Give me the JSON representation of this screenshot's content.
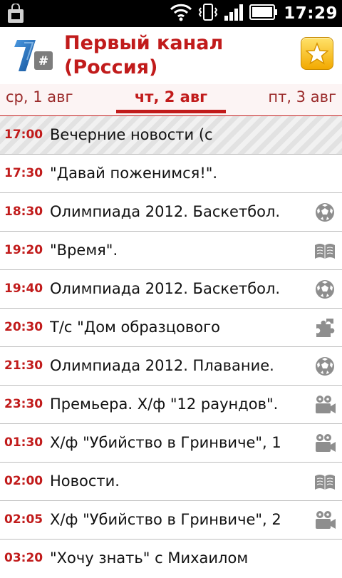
{
  "status_bar": {
    "time": "17:29",
    "icons": [
      "shopping-bag-icon",
      "wifi-icon",
      "vibrate-icon",
      "signal-icon",
      "battery-icon"
    ]
  },
  "header": {
    "logo_icon": "channel-one-logo",
    "title": "Первый канал (Россия)",
    "favorite_icon": "star-icon"
  },
  "date_tabs": {
    "prev": "ср, 1 авг",
    "current": "чт, 2 авг",
    "next": "пт, 3 авг"
  },
  "colors": {
    "accent": "#c11b1b",
    "star_button": "#f5b800"
  },
  "programs": [
    {
      "time": "17:00",
      "title": "Вечерние новости (с",
      "icon": "",
      "current": true
    },
    {
      "time": "17:30",
      "title": "\"Давай поженимся!\".",
      "icon": ""
    },
    {
      "time": "18:30",
      "title": "Олимпиада 2012. Баскетбол.",
      "icon": "sport-ball-icon"
    },
    {
      "time": "19:20",
      "title": "\"Время\".",
      "icon": "open-book-icon"
    },
    {
      "time": "19:40",
      "title": "Олимпиада 2012. Баскетбол.",
      "icon": "sport-ball-icon"
    },
    {
      "time": "20:30",
      "title": "Т/с \"Дом образцового",
      "icon": "puzzle-icon"
    },
    {
      "time": "21:30",
      "title": "Олимпиада 2012. Плавание.",
      "icon": "sport-ball-icon"
    },
    {
      "time": "23:30",
      "title": "Премьера. Х/ф \"12 раундов\".",
      "icon": "movie-camera-icon"
    },
    {
      "time": "01:30",
      "title": "Х/ф \"Убийство в Гринвиче\", 1",
      "icon": "movie-camera-icon"
    },
    {
      "time": "02:00",
      "title": "Новости.",
      "icon": "open-book-icon"
    },
    {
      "time": "02:05",
      "title": "Х/ф \"Убийство в Гринвиче\", 2",
      "icon": "movie-camera-icon"
    },
    {
      "time": "03:20",
      "title": "\"Хочу знать\" с Михаилом",
      "icon": ""
    }
  ]
}
